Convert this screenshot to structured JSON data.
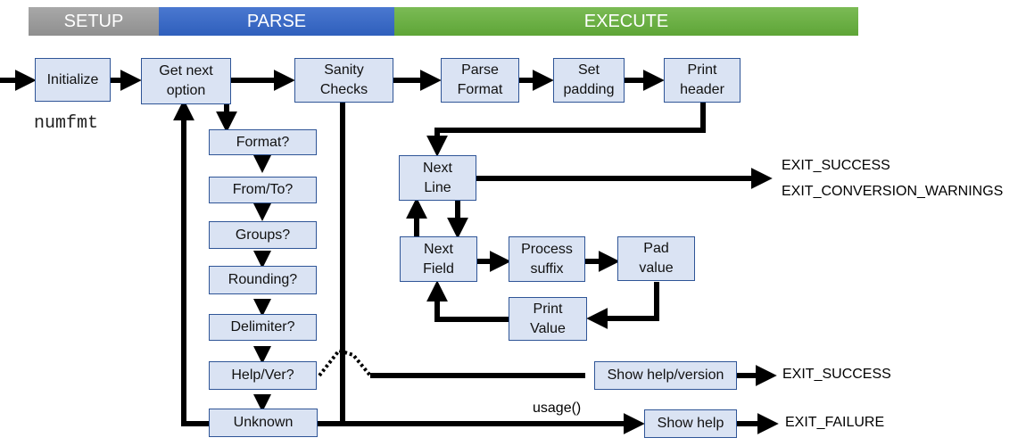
{
  "phases": {
    "setup": "SETUP",
    "parse": "PARSE",
    "execute": "EXECUTE"
  },
  "program_name": "numfmt",
  "nodes": {
    "initialize": "Initialize",
    "get_next_option": "Get next\noption",
    "sanity_checks": "Sanity\nChecks",
    "parse_format": "Parse\nFormat",
    "set_padding": "Set\npadding",
    "print_header": "Print\nheader",
    "format_q": "Format?",
    "from_to_q": "From/To?",
    "groups_q": "Groups?",
    "rounding_q": "Rounding?",
    "delimiter_q": "Delimiter?",
    "help_ver_q": "Help/Ver?",
    "unknown": "Unknown",
    "next_line": "Next\nLine",
    "next_field": "Next\nField",
    "process_suffix": "Process\nsuffix",
    "pad_value": "Pad\nvalue",
    "print_value": "Print\nValue",
    "show_help_version": "Show help/version",
    "show_help": "Show help"
  },
  "exits": {
    "main_success": "EXIT_SUCCESS",
    "main_warnings": "EXIT_CONVERSION_WARNINGS",
    "help_success": "EXIT_SUCCESS",
    "failure": "EXIT_FAILURE"
  },
  "edge_labels": {
    "usage": "usage()"
  }
}
